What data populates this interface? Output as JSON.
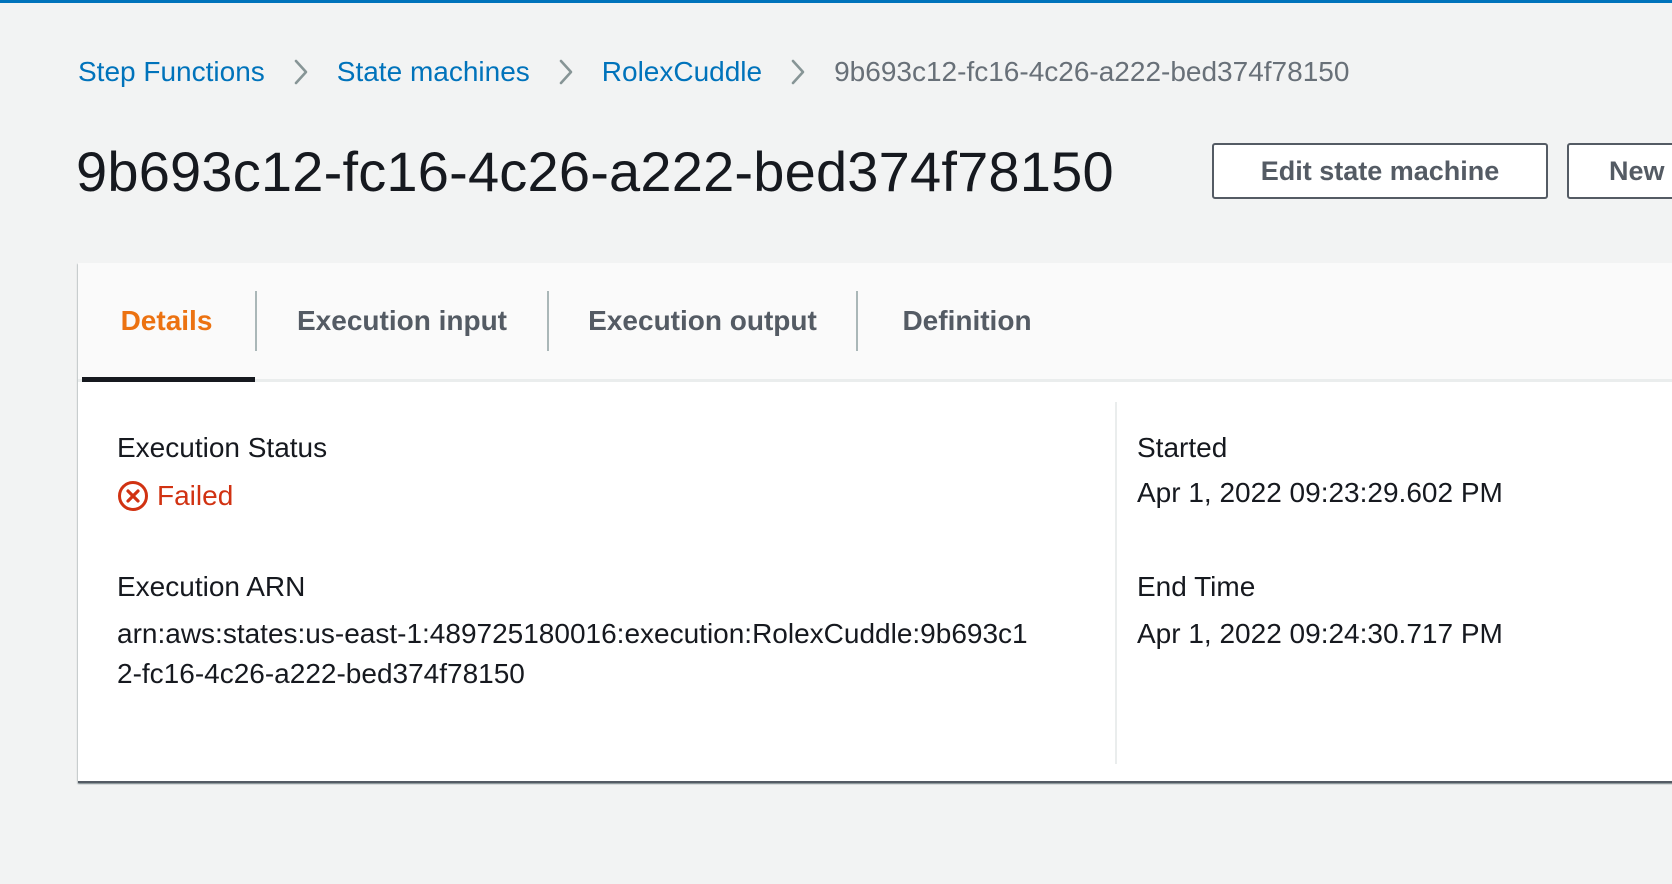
{
  "breadcrumb": {
    "items": [
      {
        "label": "Step Functions"
      },
      {
        "label": "State machines"
      },
      {
        "label": "RolexCuddle"
      }
    ],
    "current": "9b693c12-fc16-4c26-a222-bed374f78150"
  },
  "header": {
    "title": "9b693c12-fc16-4c26-a222-bed374f78150",
    "edit_button_label": "Edit state machine",
    "new_button_label": "New"
  },
  "tabs": [
    {
      "label": "Details",
      "active": true
    },
    {
      "label": "Execution input",
      "active": false
    },
    {
      "label": "Execution output",
      "active": false
    },
    {
      "label": "Definition",
      "active": false
    }
  ],
  "details": {
    "status_label": "Execution Status",
    "status_value": "Failed",
    "status_icon": "x-circle-icon",
    "arn_label": "Execution ARN",
    "arn_value": "arn:aws:states:us-east-1:489725180016:execution:RolexCuddle:9b693c12-fc16-4c26-a222-bed374f78150",
    "started_label": "Started",
    "started_value": "Apr 1, 2022 09:23:29.602 PM",
    "end_label": "End Time",
    "end_value": "Apr 1, 2022 09:24:30.717 PM"
  },
  "colors": {
    "link": "#0073bb",
    "active_tab": "#ec7211",
    "error": "#d13212"
  }
}
